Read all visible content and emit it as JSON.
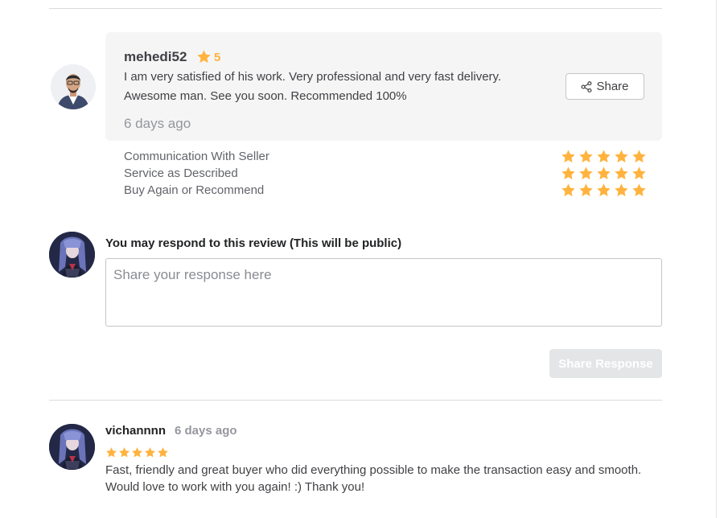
{
  "colors": {
    "star": "#ffb33e",
    "muted_text": "#95979d",
    "card_bg": "#f5f5f5",
    "disabled_button": "#e4e5e7"
  },
  "seller_review": {
    "reviewer_name": "mehedi52",
    "rating": "5",
    "text": "I am very satisfied of his work. Very professional and very fast delivery. Awesome man. See you soon. Recommended 100%",
    "time_ago": "6 days ago",
    "share_label": "Share",
    "avatar_icon": "user-photo-avatar"
  },
  "rating_breakdown": [
    {
      "label": "Communication With Seller",
      "stars": 5
    },
    {
      "label": "Service as Described",
      "stars": 5
    },
    {
      "label": "Buy Again or Recommend",
      "stars": 5
    }
  ],
  "response": {
    "label": "You may respond to this review (This will be public)",
    "placeholder": "Share your response here",
    "value": "",
    "button_label": "Share Response",
    "button_disabled": true,
    "avatar_icon": "anime-character-avatar"
  },
  "buyer_review": {
    "reviewer_name": "vichannnn",
    "time_ago": "6 days ago",
    "stars": 5,
    "text": "Fast, friendly and great buyer who did everything possible to make the transaction easy and smooth. Would love to work with you again! :) Thank you!",
    "avatar_icon": "anime-character-avatar"
  }
}
